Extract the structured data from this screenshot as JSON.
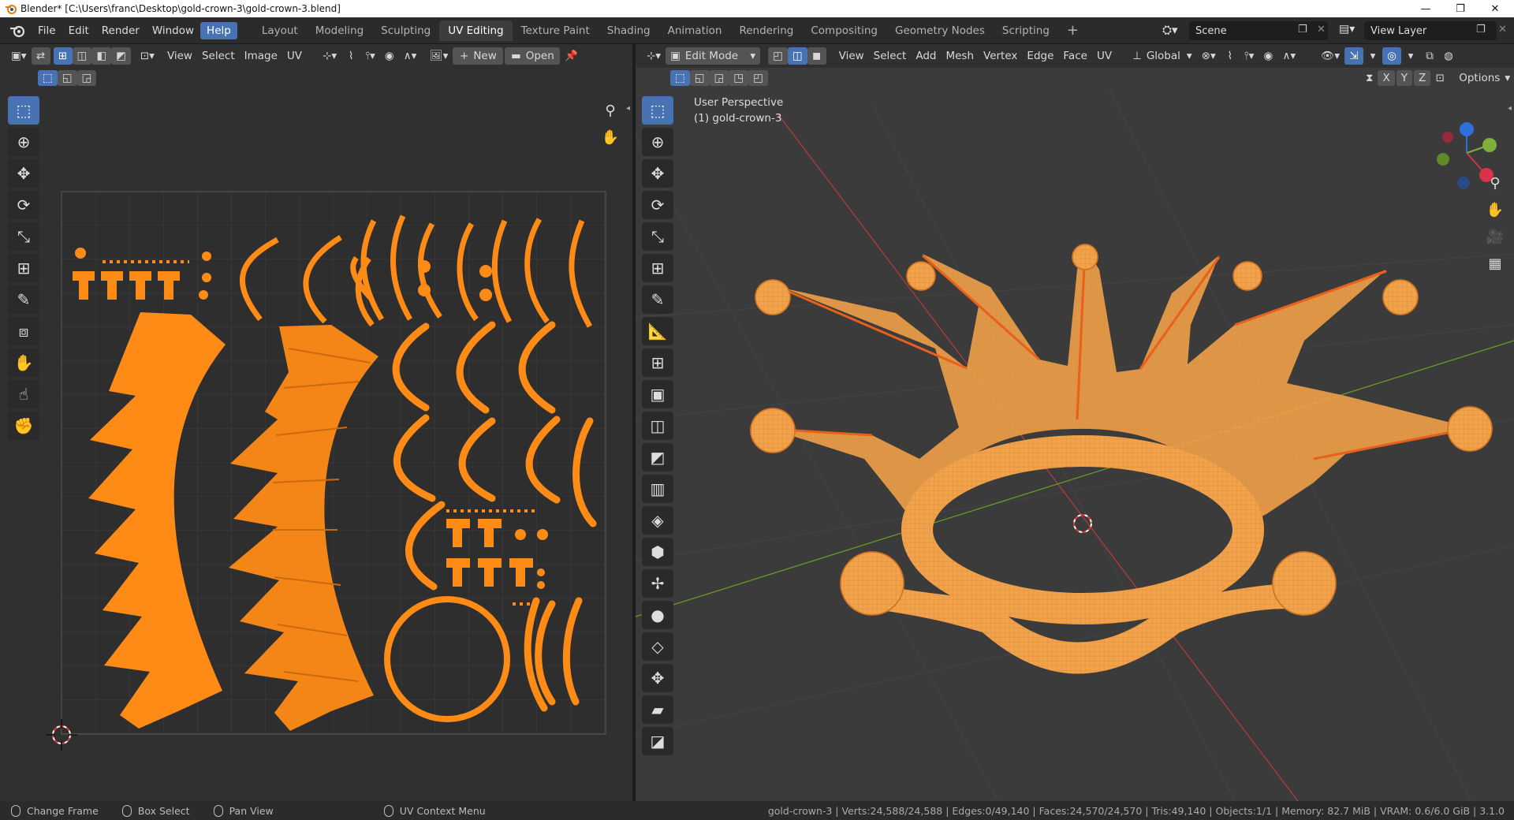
{
  "window": {
    "title": "Blender* [C:\\Users\\franc\\Desktop\\gold-crown-3\\gold-crown-3.blend]"
  },
  "menu": [
    "File",
    "Edit",
    "Render",
    "Window",
    "Help"
  ],
  "workspaces": [
    "Layout",
    "Modeling",
    "Sculpting",
    "UV Editing",
    "Texture Paint",
    "Shading",
    "Animation",
    "Rendering",
    "Compositing",
    "Geometry Nodes",
    "Scripting"
  ],
  "active_workspace": "UV Editing",
  "scene": {
    "scene_name": "Scene",
    "view_layer": "View Layer"
  },
  "uv_editor": {
    "menus": [
      "View",
      "Select",
      "Image",
      "UV"
    ],
    "new_label": "New",
    "open_label": "Open"
  },
  "viewport": {
    "mode": "Edit Mode",
    "menus": [
      "View",
      "Select",
      "Add",
      "Mesh",
      "Vertex",
      "Edge",
      "Face",
      "UV"
    ],
    "orientation": "Global",
    "axes": [
      "X",
      "Y",
      "Z"
    ],
    "options_label": "Options",
    "overlay_title": "User Perspective",
    "overlay_object": "(1) gold-crown-3"
  },
  "status": {
    "left": [
      "Change Frame",
      "Box Select",
      "Pan View",
      "UV Context Menu"
    ],
    "right": "gold-crown-3 | Verts:24,588/24,588 | Edges:0/49,140 | Faces:24,570/24,570 | Tris:49,140 | Objects:1/1 | Memory: 82.7 MiB | VRAM: 0.6/6.0 GiB | 3.1.0"
  },
  "colors": {
    "accent": "#4772b3",
    "uv_orange": "#ff8b17",
    "mesh_orange": "#f3a24a",
    "bg_editor": "#303030",
    "bg_viewport": "#3b3b3b"
  }
}
